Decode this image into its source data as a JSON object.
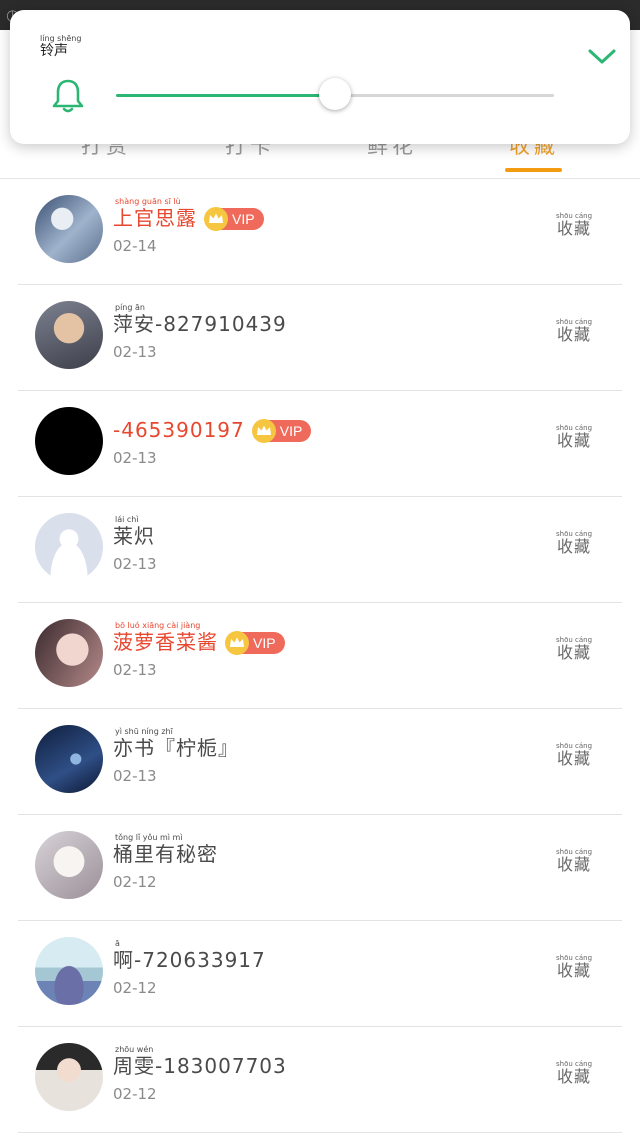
{
  "volume_panel": {
    "title": "铃声",
    "title_pinyin": "líng shēng",
    "level": 0.5
  },
  "tabs": [
    {
      "label": "打赏",
      "active": false
    },
    {
      "label": "打卡",
      "active": false
    },
    {
      "label": "鲜花",
      "active": false
    },
    {
      "label": "收藏",
      "active": true
    }
  ],
  "favorite_label": "收藏",
  "favorite_pinyin": "shōu cáng",
  "vip_label": "VIP",
  "colors": {
    "accent_green": "#2bb673",
    "accent_orange": "#f39c12",
    "vip_red": "#e8472f"
  },
  "users": [
    {
      "name": "上官思露",
      "pinyin": "shàng guān sī lù",
      "date": "02-14",
      "vip": true
    },
    {
      "name": "萍安-827910439",
      "pinyin": "píng ān",
      "date": "02-13",
      "vip": false
    },
    {
      "name": "-465390197",
      "pinyin": "",
      "date": "02-13",
      "vip": true
    },
    {
      "name": "莱炽",
      "pinyin": "lái chì",
      "date": "02-13",
      "vip": false
    },
    {
      "name": "菠萝香菜酱",
      "pinyin": "bō luó xiāng cài jiàng",
      "date": "02-13",
      "vip": true
    },
    {
      "name": "亦书『柠栀』",
      "pinyin": "yì shū   níng zhī",
      "date": "02-13",
      "vip": false
    },
    {
      "name": "桶里有秘密",
      "pinyin": "tǒng lǐ yǒu mì mì",
      "date": "02-12",
      "vip": false
    },
    {
      "name": "啊-720633917",
      "pinyin": "ā",
      "date": "02-12",
      "vip": false
    },
    {
      "name": "周雯-183007703",
      "pinyin": "zhōu wén",
      "date": "02-12",
      "vip": false
    }
  ]
}
